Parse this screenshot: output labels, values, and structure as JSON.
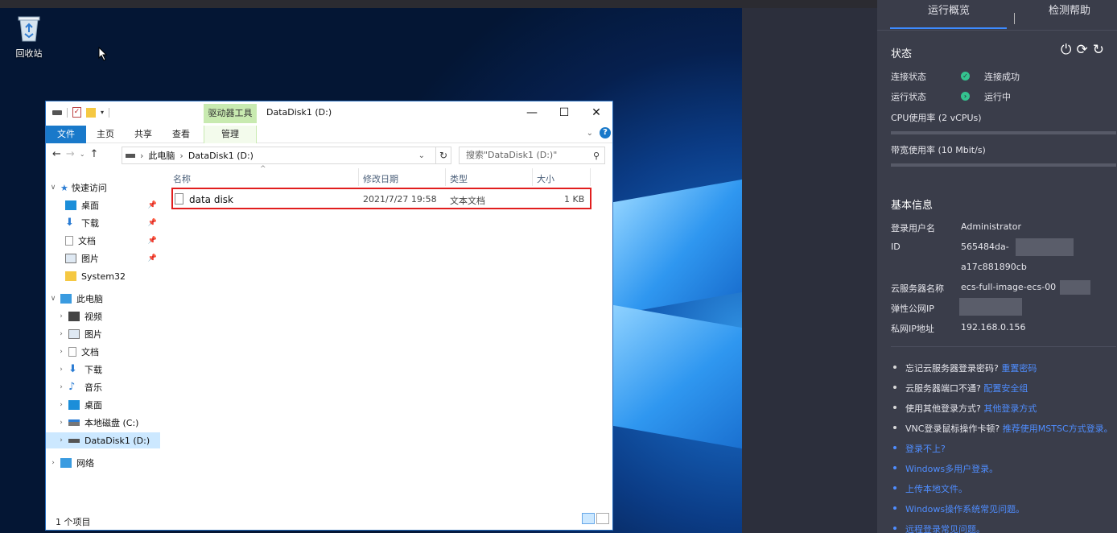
{
  "desktop": {
    "recycle_bin_label": "回收站"
  },
  "explorer": {
    "title": "DataDisk1 (D:)",
    "context_tab": "驱动器工具",
    "ribbon_tabs": [
      "文件",
      "主页",
      "共享",
      "查看",
      "管理"
    ],
    "address": {
      "crumbs": [
        "此电脑",
        "DataDisk1 (D:)"
      ]
    },
    "search_placeholder": "搜索\"DataDisk1 (D:)\"",
    "nav": {
      "quick_access": "快速访问",
      "desktop": "桌面",
      "downloads": "下载",
      "documents": "文档",
      "pictures": "图片",
      "system32": "System32",
      "this_pc": "此电脑",
      "videos": "视频",
      "pictures2": "图片",
      "documents2": "文档",
      "downloads2": "下载",
      "music": "音乐",
      "desktop2": "桌面",
      "local_disk": "本地磁盘 (C:)",
      "data_disk": "DataDisk1 (D:)",
      "network": "网络"
    },
    "columns": {
      "name": "名称",
      "modified": "修改日期",
      "type": "类型",
      "size": "大小"
    },
    "files": [
      {
        "name": "data disk",
        "modified": "2021/7/27 19:58",
        "type": "文本文档",
        "size": "1 KB"
      }
    ],
    "status": "1 个项目"
  },
  "panel": {
    "tabs": [
      "运行概览",
      "检测帮助"
    ],
    "status": {
      "title": "状态",
      "connection_label": "连接状态",
      "connection_value": "连接成功",
      "running_label": "运行状态",
      "running_value": "运行中",
      "cpu_label": "CPU使用率 (2 vCPUs)",
      "bandwidth_label": "带宽使用率 (10 Mbit/s)"
    },
    "basic": {
      "title": "基本信息",
      "user_label": "登录用户名",
      "user_value": "Administrator",
      "id_label": "ID",
      "id_value_1": "565484da-",
      "id_value_2": "a17c881890cb",
      "name_label": "云服务器名称",
      "name_value": "ecs-full-image-ecs-00",
      "eip_label": "弹性公网IP",
      "private_ip_label": "私网IP地址",
      "private_ip_value": "192.168.0.156"
    },
    "help": [
      {
        "text": "忘记云服务器登录密码?",
        "link": "重置密码"
      },
      {
        "text": "云服务器端口不通?",
        "link": "配置安全组"
      },
      {
        "text": "使用其他登录方式?",
        "link": "其他登录方式"
      },
      {
        "text": "VNC登录鼠标操作卡顿?",
        "link": "推荐使用MSTSC方式登录。"
      }
    ],
    "links": [
      "登录不上?",
      "Windows多用户登录。",
      "上传本地文件。",
      "Windows操作系统常见问题。",
      "远程登录常见问题。"
    ],
    "colors": {
      "accent": "#3d8bff",
      "link": "#4f8dff",
      "ok": "#34c38f",
      "highlight": "#e11e1e"
    }
  }
}
